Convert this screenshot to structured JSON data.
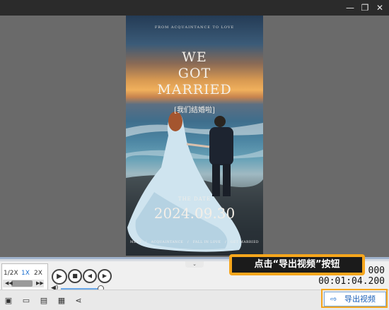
{
  "window": {
    "minimize_icon": "—",
    "restore_icon": "❐",
    "close_icon": "✕"
  },
  "poster": {
    "top_text": "FROM ACQUAINTANCE TO LOVE",
    "headline": "WE GOT MARRIED",
    "chinese_title": "[我们结婚啦]",
    "date_label": "THE DATE",
    "date": "2024.09.30",
    "footer": [
      "MEET",
      "/",
      "ACQUAINTANCE",
      "/",
      "FALL IN LOVE",
      "/",
      "GET MARRIED"
    ]
  },
  "hide_tab_label": "⌄",
  "speed": {
    "options": [
      "1/2X",
      "1X",
      "2X"
    ],
    "selected": "1X"
  },
  "time": {
    "current_partial": "00:01:04.200",
    "current_top": "000"
  },
  "callout": {
    "text": "点击“导出视频”按钮"
  },
  "export": {
    "label": "导出视频"
  },
  "colors": {
    "accent": "#f6a61c",
    "blue": "#1a6fd0"
  }
}
